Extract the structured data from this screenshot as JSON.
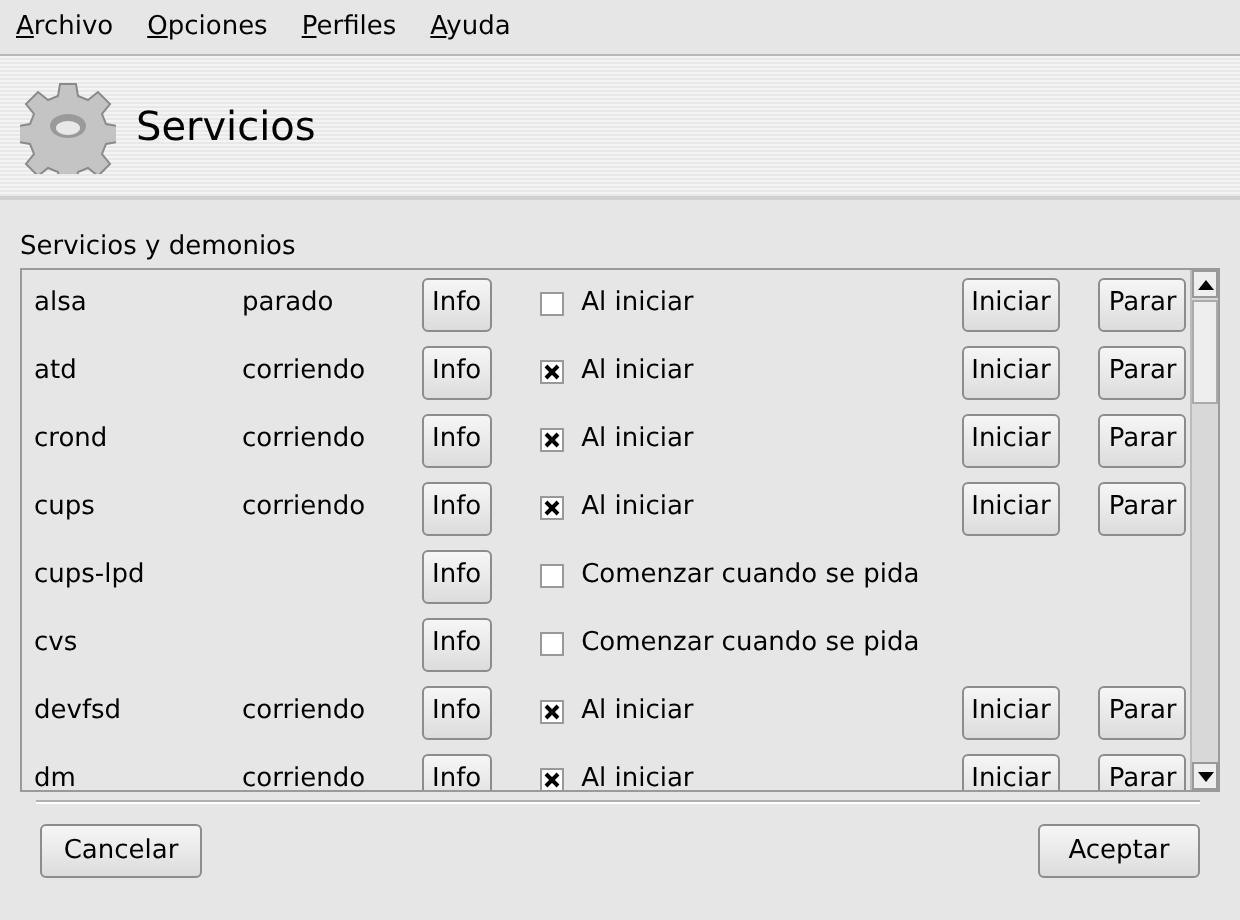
{
  "menu": [
    "Archivo",
    "Opciones",
    "Perfiles",
    "Ayuda"
  ],
  "header": {
    "title": "Servicios"
  },
  "group": {
    "title": "Servicios y demonios",
    "rows": [
      {
        "kind": "daemon",
        "name": "alsa",
        "status": "parado",
        "info": "Info",
        "checked": false,
        "start_label": "Al iniciar",
        "start": "Iniciar",
        "stop": "Parar"
      },
      {
        "kind": "daemon",
        "name": "atd",
        "status": "corriendo",
        "info": "Info",
        "checked": true,
        "start_label": "Al iniciar",
        "start": "Iniciar",
        "stop": "Parar"
      },
      {
        "kind": "daemon",
        "name": "crond",
        "status": "corriendo",
        "info": "Info",
        "checked": true,
        "start_label": "Al iniciar",
        "start": "Iniciar",
        "stop": "Parar"
      },
      {
        "kind": "daemon",
        "name": "cups",
        "status": "corriendo",
        "info": "Info",
        "checked": true,
        "start_label": "Al iniciar",
        "start": "Iniciar",
        "stop": "Parar"
      },
      {
        "kind": "on-demand",
        "name": "cups-lpd",
        "info": "Info",
        "checked": false,
        "start_label": "Comenzar cuando se pida"
      },
      {
        "kind": "on-demand",
        "name": "cvs",
        "info": "Info",
        "checked": false,
        "start_label": "Comenzar cuando se pida"
      },
      {
        "kind": "daemon",
        "name": "devfsd",
        "status": "corriendo",
        "info": "Info",
        "checked": true,
        "start_label": "Al iniciar",
        "start": "Iniciar",
        "stop": "Parar"
      },
      {
        "kind": "daemon",
        "name": "dm",
        "status": "corriendo",
        "info": "Info",
        "checked": true,
        "start_label": "Al iniciar",
        "start": "Iniciar",
        "stop": "Parar"
      }
    ]
  },
  "buttons": {
    "cancel": "Cancelar",
    "accept": "Aceptar"
  }
}
